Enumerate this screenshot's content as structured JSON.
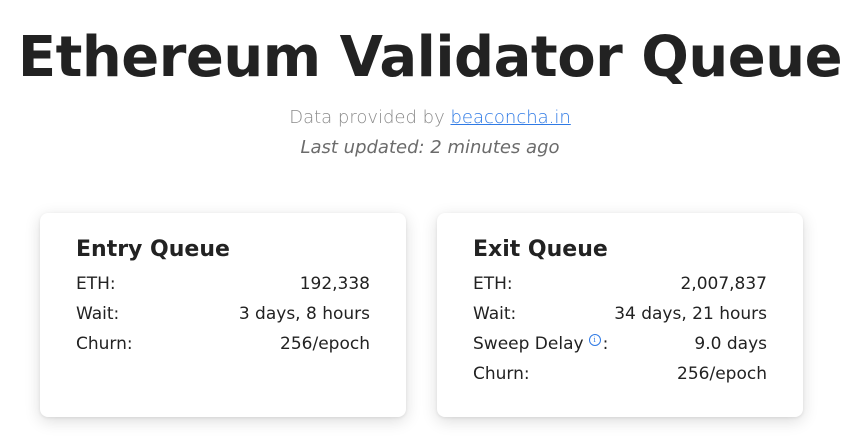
{
  "header": {
    "title": "Ethereum Validator Queue",
    "provider_prefix": "Data provided by",
    "provider_link": "beaconcha.in",
    "last_updated": "Last updated: 2 minutes ago"
  },
  "entry_queue": {
    "title": "Entry Queue",
    "rows": [
      {
        "label": "ETH:",
        "value": "192,338"
      },
      {
        "label": "Wait:",
        "value": "3 days, 8 hours"
      },
      {
        "label": "Churn:",
        "value": "256/epoch"
      }
    ]
  },
  "exit_queue": {
    "title": "Exit Queue",
    "rows": [
      {
        "label": "ETH:",
        "value": "2,007,837"
      },
      {
        "label": "Wait:",
        "value": "34 days, 21 hours"
      },
      {
        "label": "Sweep Delay",
        "suffix": ":",
        "value": "9.0 days",
        "icon": "info-icon"
      },
      {
        "label": "Churn:",
        "value": "256/epoch"
      }
    ]
  },
  "colors": {
    "link": "#2f7ae5",
    "text": "#222222",
    "muted": "#8a8a8a"
  }
}
